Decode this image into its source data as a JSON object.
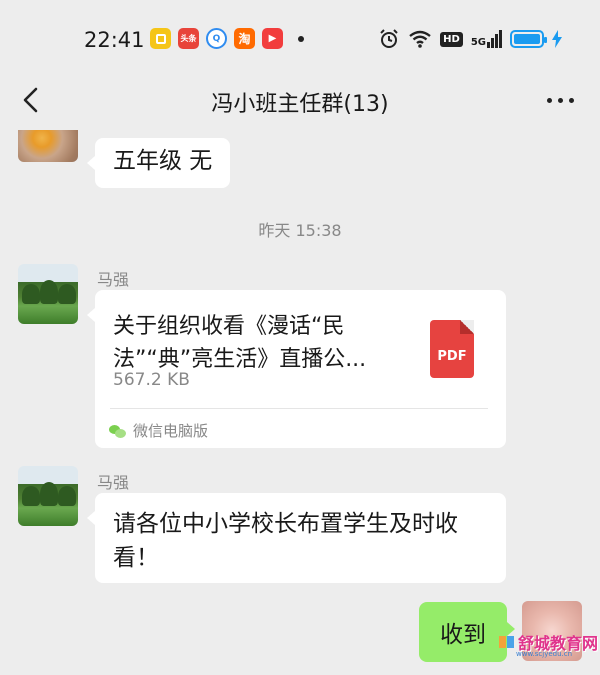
{
  "status_bar": {
    "time": "22:41",
    "app_icons": [
      {
        "name": "notes-app-icon",
        "label": "",
        "color": "#f5c518"
      },
      {
        "name": "toutiao-app-icon",
        "label": "头条",
        "color": "#e8443a"
      },
      {
        "name": "browser-app-icon",
        "label": "Q",
        "color": "#2f8cf0"
      },
      {
        "name": "taobao-app-icon",
        "label": "淘",
        "color": "#ff6a00"
      },
      {
        "name": "video-app-icon",
        "label": "▶",
        "color": "#f23d3d"
      }
    ],
    "hd_label": "HD",
    "network_label": "5G",
    "battery_level": 1.0
  },
  "header": {
    "title": "冯小班主任群(13)"
  },
  "messages": {
    "m1": {
      "text": "五年级 无"
    },
    "timestamp": "昨天 15:38",
    "m2": {
      "sender": "马强",
      "file_title": "关于组织收看《漫话“民法”“典”亮生活》直播公...",
      "file_size": "567.2 KB",
      "file_type": "PDF",
      "source": "微信电脑版"
    },
    "m3": {
      "sender": "马强",
      "text": "请各位中小学校长布置学生及时收看！"
    },
    "m4": {
      "text": "收到"
    }
  },
  "watermark": {
    "text": "舒城教育网",
    "sub": "www.scjyedu.cn"
  },
  "colors": {
    "background": "#ededed",
    "self_bubble": "#95ec69",
    "pdf": "#e64340"
  }
}
